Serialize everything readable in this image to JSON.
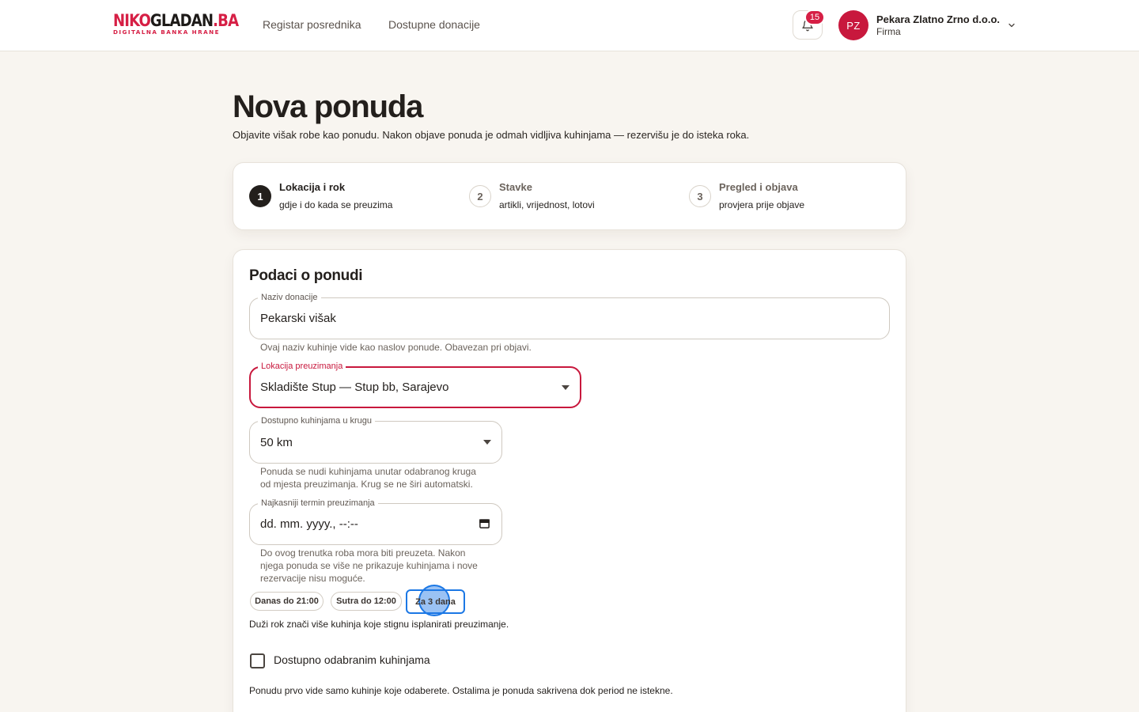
{
  "header": {
    "logo_part1": "NIKO",
    "logo_part2": "GLADAN",
    "logo_part3": ".BA",
    "logo_sub": "DIGITALNA BANKA HRANE",
    "nav": [
      {
        "label": "Registar posrednika"
      },
      {
        "label": "Dostupne donacije"
      }
    ],
    "notifications_count": "15",
    "user": {
      "initials": "PZ",
      "name": "Pekara Zlatno Zrno d.o.o.",
      "role": "Firma"
    }
  },
  "page": {
    "title": "Nova ponuda",
    "subtitle": "Objavite višak robe kao ponudu. Nakon objave ponuda je odmah vidljiva kuhinjama — rezervišu je do isteka roka."
  },
  "steps": [
    {
      "number": "1",
      "title": "Lokacija i rok",
      "desc": "gdje i do kada se preuzima",
      "active": true
    },
    {
      "number": "2",
      "title": "Stavke",
      "desc": "artikli, vrijednost, lotovi",
      "active": false
    },
    {
      "number": "3",
      "title": "Pregled i objava",
      "desc": "provjera prije objave",
      "active": false
    }
  ],
  "form": {
    "section_title": "Podaci o ponudi",
    "name_field": {
      "label": "Naziv donacije",
      "value": "Pekarski višak",
      "helper": "Ovaj naziv kuhinje vide kao naslov ponude. Obavezan pri objavi."
    },
    "location_field": {
      "label": "Lokacija preuzimanja",
      "value": "Skladište Stup — Stup bb, Sarajevo"
    },
    "radius_field": {
      "label": "Dostupno kuhinjama u krugu",
      "value": "50 km",
      "helper_line1": "Ponuda se nudi kuhinjama unutar odabranog kruga",
      "helper_line2": "od mjesta preuzimanja. Krug se ne širi automatski."
    },
    "deadline_field": {
      "label": "Najkasniji termin preuzimanja",
      "value": "dd. mm. yyyy., --:--",
      "helper_line1": "Do ovog trenutka roba mora biti preuzeta. Nakon",
      "helper_line2": "njega ponuda se više ne prikazuje kuhinjama i nove",
      "helper_line3": "rezervacije nisu moguće."
    },
    "quick_chips": [
      {
        "label": "Danas do 21:00"
      },
      {
        "label": "Sutra do 12:00"
      },
      {
        "label": "Za 3 dana"
      }
    ],
    "deadline_note": "Duži rok znači više kuhinja koje stignu isplanirati preuzimanje.",
    "selected_kitchens_label": "Dostupno odabranim kuhinjama",
    "selected_kitchens_note": "Ponudu prvo vide samo kuhinje koje odaberete. Ostalima je ponuda sakrivena dok period ne istekne."
  },
  "colors": {
    "brand": "#d61f45",
    "focus": "#c8183d",
    "selection": "#1c78e5",
    "background": "#f8f5f0"
  }
}
